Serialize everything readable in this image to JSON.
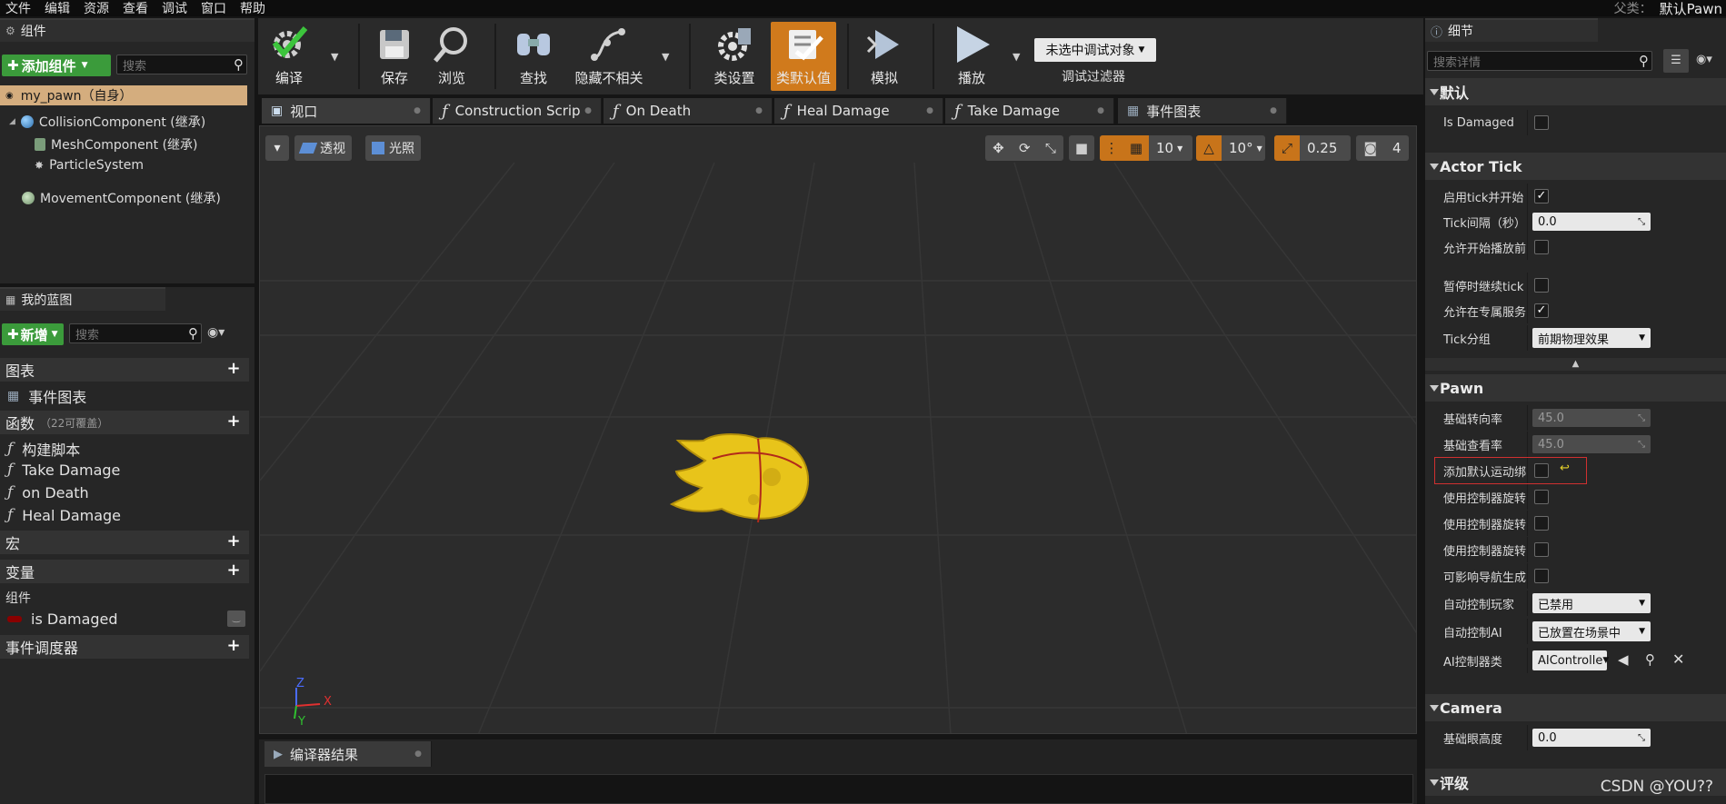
{
  "menubar": {
    "items": [
      "文件",
      "编辑",
      "资源",
      "查看",
      "调试",
      "窗口",
      "帮助"
    ],
    "parent_label": "父类：",
    "parent_value": "默认Pawn"
  },
  "components_panel": {
    "title": "组件",
    "add_button": "添加组件",
    "search_placeholder": "搜索",
    "root": "my_pawn（自身）",
    "tree": [
      "CollisionComponent (继承)",
      "MeshComponent (继承)",
      "ParticleSystem",
      "MovementComponent (继承)"
    ]
  },
  "my_blueprint_panel": {
    "title": "我的蓝图",
    "new_button": "新增",
    "search_placeholder": "搜索",
    "graphs_label": "图表",
    "event_graph": "事件图表",
    "functions_label": "函数",
    "functions_count": "（22可覆盖）",
    "functions": [
      "构建脚本",
      "Take Damage",
      "on Death",
      "Heal Damage"
    ],
    "macros_label": "宏",
    "variables_label": "变量",
    "components_sub": "组件",
    "variable_item": "is Damaged",
    "dispatchers_label": "事件调度器"
  },
  "toolbar": {
    "buttons": [
      "编译",
      "保存",
      "浏览",
      "查找",
      "隐藏不相关",
      "类设置",
      "类默认值",
      "模拟",
      "播放"
    ],
    "debug_dropdown": "未选中调试对象",
    "debug_filter": "调试过滤器"
  },
  "editor_tabs": [
    "视口",
    "Construction Scrip",
    "On Death",
    "Heal Damage",
    "Take Damage",
    "事件图表"
  ],
  "viewport": {
    "menu_button": "▾",
    "perspective": "透视",
    "lighting": "光照",
    "grid_snap": "10",
    "rotation_snap": "10°",
    "scale_snap": "0.25",
    "camera_speed": "4",
    "axis_x": "X",
    "axis_y": "Y",
    "axis_z": "Z"
  },
  "compiler_tab": "编译器结果",
  "details": {
    "title": "细节",
    "search_placeholder": "搜索详情",
    "sections": {
      "default": "默认",
      "actor_tick": "Actor Tick",
      "pawn": "Pawn",
      "camera": "Camera",
      "rating": "评级"
    },
    "is_damaged": "Is Damaged",
    "tick": {
      "start_with_tick": "启用tick并开始",
      "tick_interval": "Tick间隔（秒）",
      "tick_interval_value": "0.0",
      "allow_before_play": "允许开始播放前",
      "tick_when_paused": "暂停时继续tick",
      "allow_dedicated_server": "允许在专属服务",
      "tick_group": "Tick分组",
      "tick_group_value": "前期物理效果"
    },
    "pawn": {
      "base_turn_rate": "基础转向率",
      "base_turn_rate_value": "45.0",
      "base_lookup_rate": "基础查看率",
      "base_lookup_rate_value": "45.0",
      "add_default_movement": "添加默认运动绑",
      "use_controller_rotation_1": "使用控制器旋转",
      "use_controller_rotation_2": "使用控制器旋转",
      "use_controller_rotation_3": "使用控制器旋转",
      "can_affect_navigation": "可影响导航生成",
      "auto_possess_player": "自动控制玩家",
      "auto_possess_player_value": "已禁用",
      "auto_possess_ai": "自动控制AI",
      "auto_possess_ai_value": "已放置在场景中",
      "ai_controller_class": "AI控制器类",
      "ai_controller_class_value": "AIControlle"
    },
    "camera": {
      "base_eye_height": "基础眼高度",
      "base_eye_height_value": "0.0"
    }
  },
  "watermark": "CSDN @YOU??",
  "colors": {
    "accent_orange": "#c8741a",
    "add_green": "#3b9b3b",
    "highlight_red": "#d03030",
    "mesh_yellow": "#e8c41a"
  }
}
